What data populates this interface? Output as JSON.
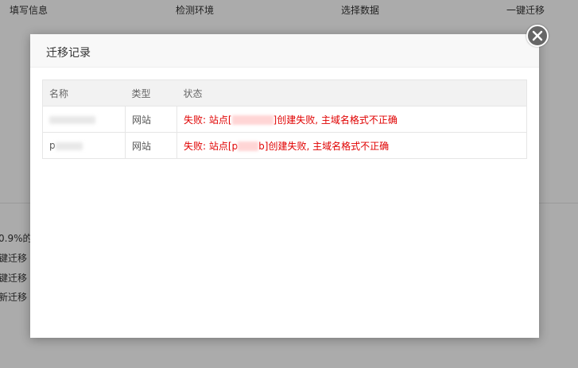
{
  "steps": [
    "填写信息",
    "检测环境",
    "选择数据",
    "一键迁移"
  ],
  "background_lines": [
    "0.9%的",
    "键迁移",
    "键迁移",
    "新迁移"
  ],
  "modal": {
    "title": "迁移记录",
    "close_icon": "close-icon"
  },
  "table": {
    "headers": [
      "名称",
      "类型",
      "状态"
    ],
    "rows": [
      {
        "name_visible": "",
        "type": "网站",
        "status_prefix": "失败: 站点[",
        "status_middle": "",
        "status_suffix": "]创建失败, 主域名格式不正确"
      },
      {
        "name_visible": "p",
        "type": "网站",
        "status_prefix": "失败: 站点[p",
        "status_middle": "b",
        "status_suffix": "]创建失败, 主域名格式不正确"
      }
    ]
  },
  "colors": {
    "error": "#e00000",
    "overlay": "rgba(0,0,0,0.33)",
    "close_button": "#666666"
  }
}
